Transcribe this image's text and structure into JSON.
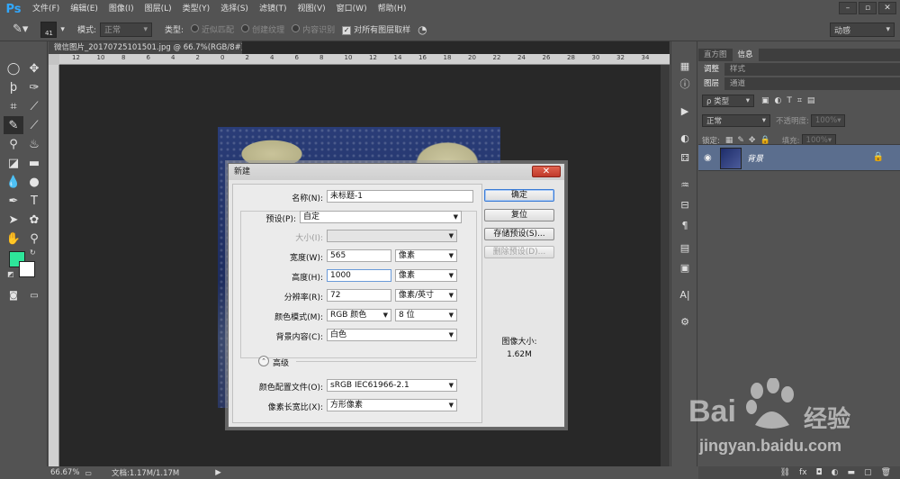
{
  "app": {
    "logo": "Ps",
    "menu": [
      "文件(F)",
      "编辑(E)",
      "图像(I)",
      "图层(L)",
      "类型(Y)",
      "选择(S)",
      "滤镜(T)",
      "视图(V)",
      "窗口(W)",
      "帮助(H)"
    ],
    "window_controls": [
      "–",
      "▫",
      "✕"
    ]
  },
  "options_bar": {
    "brush_size": "41",
    "mode_label": "模式:",
    "mode_value": "正常",
    "type_label": "类型:",
    "type_options": [
      "近似匹配",
      "创建纹理",
      "内容识别"
    ],
    "sample_all_label": "对所有图层取样",
    "workspace": "动感"
  },
  "document": {
    "tab_title": "微信图片_20170725101501.jpg @ 66.7%(RGB/8#) *",
    "ruler_ticks": [
      "12",
      "10",
      "8",
      "6",
      "4",
      "2",
      "0",
      "2",
      "4",
      "6",
      "8",
      "10",
      "12",
      "14",
      "16",
      "18",
      "20",
      "22",
      "24",
      "26",
      "28",
      "30",
      "32",
      "34"
    ]
  },
  "status_bar": {
    "zoom": "66.67%",
    "doc_info": "文档:1.17M/1.17M"
  },
  "dialog": {
    "title": "新建",
    "name_label": "名称(N):",
    "name_value": "未标题-1",
    "preset_label": "预设(P):",
    "preset_value": "自定",
    "size_label": "大小(I):",
    "width_label": "宽度(W):",
    "width_value": "565",
    "width_unit": "像素",
    "height_label": "高度(H):",
    "height_value": "1000",
    "height_unit": "像素",
    "resolution_label": "分辨率(R):",
    "resolution_value": "72",
    "resolution_unit": "像素/英寸",
    "color_mode_label": "颜色模式(M):",
    "color_mode_value": "RGB 颜色",
    "bit_depth": "8 位",
    "bg_label": "背景内容(C):",
    "bg_value": "白色",
    "advanced_label": "高级",
    "color_profile_label": "颜色配置文件(O):",
    "color_profile_value": "sRGB IEC61966-2.1",
    "pixel_aspect_label": "像素长宽比(X):",
    "pixel_aspect_value": "方形像素",
    "ok": "确定",
    "reset": "复位",
    "save_preset": "存储预设(S)...",
    "delete_preset": "删除预设(D)...",
    "image_size_label": "图像大小:",
    "image_size_value": "1.62M"
  },
  "panels": {
    "top_tabs": [
      "直方图",
      "信息"
    ],
    "mid_tabs": [
      "调整",
      "样式"
    ],
    "layer_tabs": [
      "图层",
      "通道"
    ],
    "filter_label": "ρ 类型",
    "blend_mode": "正常",
    "opacity_label": "不透明度:",
    "opacity_value": "100%",
    "lock_label": "锁定:",
    "fill_label": "填充:",
    "fill_value": "100%",
    "layer_name": "背景"
  },
  "watermark": {
    "brand": "Bai",
    "brand2": "经验",
    "url": "jingyan.baidu.com"
  },
  "colors": {
    "foreground": "#2ee69a",
    "background": "#ffffff",
    "layer_highlight": "#5b6e8e"
  }
}
